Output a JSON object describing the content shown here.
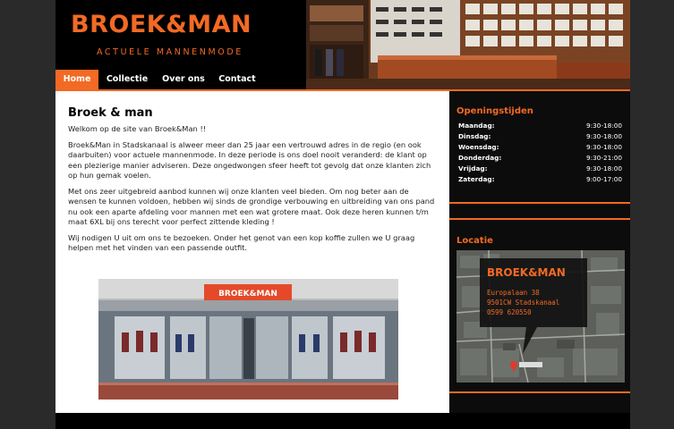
{
  "header": {
    "logo_title": "BROEK&MAN",
    "logo_subtitle": "ACTUELE MANNENMODE"
  },
  "nav": {
    "items": [
      {
        "label": "Home",
        "active": true
      },
      {
        "label": "Collectie",
        "active": false
      },
      {
        "label": "Over ons",
        "active": false
      },
      {
        "label": "Contact",
        "active": false
      }
    ]
  },
  "main": {
    "title": "Broek & man",
    "paragraphs": [
      "Welkom op de site van Broek&Man !!",
      "Broek&Man in Stadskanaal is alweer meer dan 25 jaar een vertrouwd adres in de regio (en ook daarbuiten) voor actuele mannenmode. In deze periode is ons doel nooit veranderd: de klant op een plezierige manier adviseren. Deze ongedwongen sfeer heeft tot gevolg dat onze klanten zich op hun gemak voelen.",
      "Met ons zeer uitgebreid aanbod kunnen wij onze klanten veel bieden. Om nog beter aan de wensen te kunnen voldoen, hebben wij sinds de grondige verbouwing en uitbreiding van ons pand nu ook een aparte afdeling voor mannen met een wat grotere maat. Ook deze heren kunnen t/m maat 6XL bij ons terecht voor perfect zittende kleding !",
      "Wij nodigen U uit om ons te bezoeken. Onder het genot van een kop koffie zullen we U graag helpen met het vinden van een passende outfit."
    ],
    "store_sign": "BROEK&MAN"
  },
  "sidebar": {
    "hours_title": "Openingstijden",
    "hours": [
      {
        "day": "Maandag:",
        "time": "9:30-18:00"
      },
      {
        "day": "Dinsdag:",
        "time": "9:30-18:00"
      },
      {
        "day": "Woensdag:",
        "time": "9:30-18:00"
      },
      {
        "day": "Donderdag:",
        "time": "9:30-21:00"
      },
      {
        "day": "Vrijdag:",
        "time": "9:30-18:00"
      },
      {
        "day": "Zaterdag:",
        "time": "9:00-17:00"
      }
    ],
    "location_title": "Locatie",
    "map": {
      "name": "BROEK&MAN",
      "address_line1": "Europalaan 38",
      "address_line2": "9501CW Stadskanaal",
      "phone": "0599 620550"
    }
  },
  "colors": {
    "accent": "#f26a24",
    "background": "#000000",
    "content_bg": "#ffffff"
  }
}
